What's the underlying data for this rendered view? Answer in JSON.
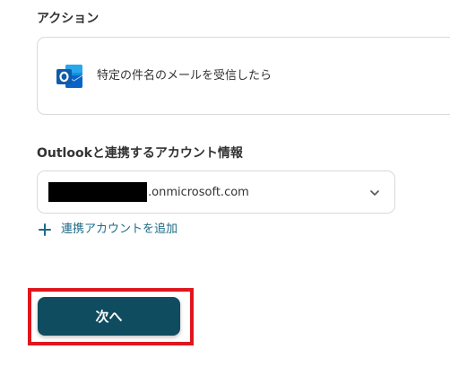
{
  "action_section": {
    "label": "アクション",
    "card_text": "特定の件名のメールを受信したら",
    "app_icon": "outlook-icon"
  },
  "account_section": {
    "label": "Outlookと連携するアカウント情報",
    "selected_account_suffix": ".onmicrosoft.com",
    "dropdown_icon": "chevron-down-icon",
    "add_account_label": "連携アカウントを追加",
    "add_icon": "plus-icon"
  },
  "footer": {
    "next_button_label": "次へ"
  },
  "colors": {
    "primary_button": "#0f4c5f",
    "link": "#1d6b86",
    "highlight": "#e0161d",
    "border": "#d9d9d9",
    "outlook_blue": "#0a64c8"
  }
}
